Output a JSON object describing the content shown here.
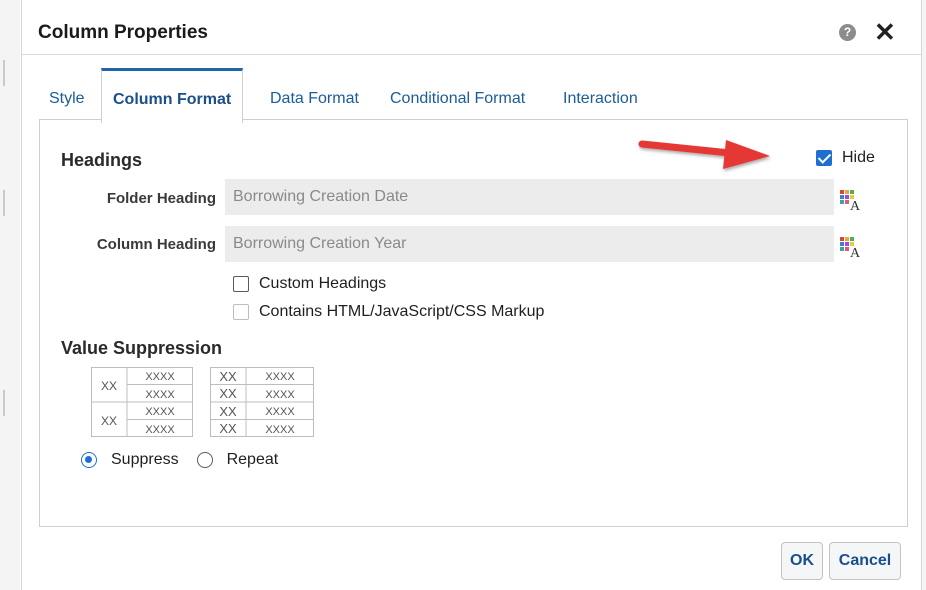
{
  "dialog": {
    "title": "Column Properties",
    "help_icon": "question-circle-icon",
    "help_glyph": "?",
    "close_icon": "close-icon",
    "close_glyph": "✕"
  },
  "tabs": [
    {
      "label": "Style",
      "active": false
    },
    {
      "label": "Column Format",
      "active": true
    },
    {
      "label": "Data Format",
      "active": false
    },
    {
      "label": "Conditional Format",
      "active": false
    },
    {
      "label": "Interaction",
      "active": false
    }
  ],
  "headings": {
    "title": "Headings",
    "hide_label": "Hide",
    "hide_checked": true,
    "folder_label": "Folder Heading",
    "folder_value": "Borrowing Creation Date",
    "column_label": "Column Heading",
    "column_value": "Borrowing Creation Year",
    "format_icon": "text-format-icon",
    "custom_headings_label": "Custom Headings",
    "custom_headings_checked": false,
    "markup_label": "Contains HTML/JavaScript/CSS Markup",
    "markup_checked": false
  },
  "value_suppression": {
    "title": "Value Suppression",
    "suppress_sample": {
      "xx": "XX",
      "xxxx": "XXXX"
    },
    "repeat_sample": {
      "xx": "XX",
      "xxxx": "XXXX"
    },
    "options": [
      {
        "label": "Suppress",
        "selected": true
      },
      {
        "label": "Repeat",
        "selected": false
      }
    ]
  },
  "annotation": {
    "arrow_color": "#e53935"
  },
  "buttons": {
    "ok": "OK",
    "cancel": "Cancel"
  },
  "colors": {
    "accent": "#1f6fd1",
    "tab_text": "#1b5c9a",
    "tab_border": "#1f64a8"
  }
}
